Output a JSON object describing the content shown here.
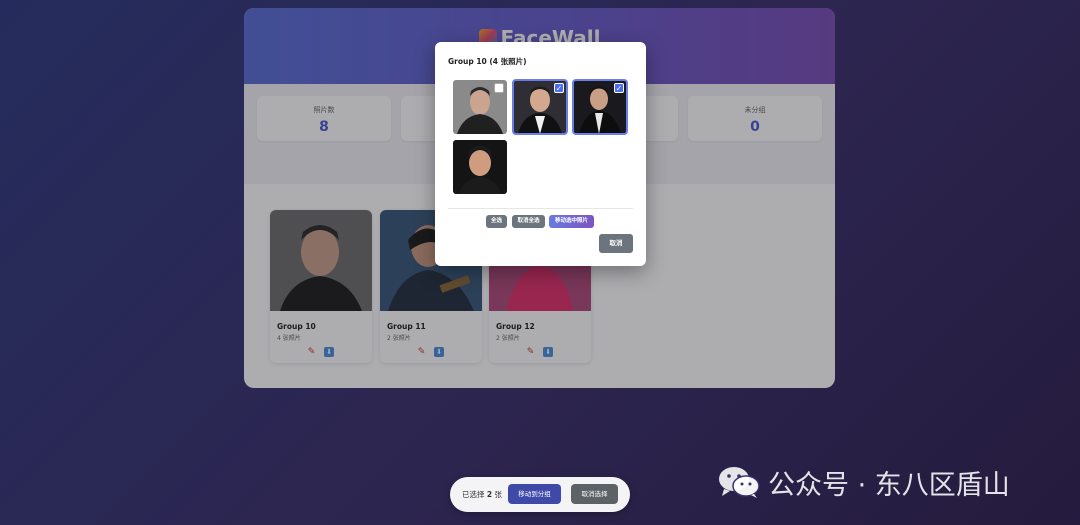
{
  "app": {
    "title": "FaceWall",
    "stats": [
      {
        "label": "照片数",
        "value": "8"
      },
      {
        "label": "",
        "value": ""
      },
      {
        "label": "",
        "value": ""
      },
      {
        "label": "未分组",
        "value": "0"
      }
    ],
    "groups": [
      {
        "name": "Group 10",
        "count": "4 张照片"
      },
      {
        "name": "Group 11",
        "count": "2 张照片"
      },
      {
        "name": "Group 12",
        "count": "2 张照片"
      }
    ],
    "actions": {
      "edit_icon": "pencil-icon",
      "download_icon": "download-icon"
    }
  },
  "modal": {
    "title": "Group 10 (4 张照片)",
    "photos": [
      {
        "selected": false
      },
      {
        "selected": true
      },
      {
        "selected": true
      },
      {
        "selected": false
      }
    ],
    "select_all_label": "全选",
    "deselect_all_label": "取消全选",
    "move_selected_label": "移动选中照片",
    "cancel_label": "取消"
  },
  "selection_bar": {
    "prefix": "已选择",
    "count": "2",
    "suffix": "张",
    "move_label": "移动到分组",
    "cancel_label": "取消选择"
  },
  "watermark": {
    "text": "公众号 · 东八区盾山"
  },
  "colors": {
    "accent": "#4b5bd6",
    "header_gradient_start": "#5a6fd6",
    "header_gradient_end": "#7b4fb5",
    "check": "#4a6cf7"
  }
}
